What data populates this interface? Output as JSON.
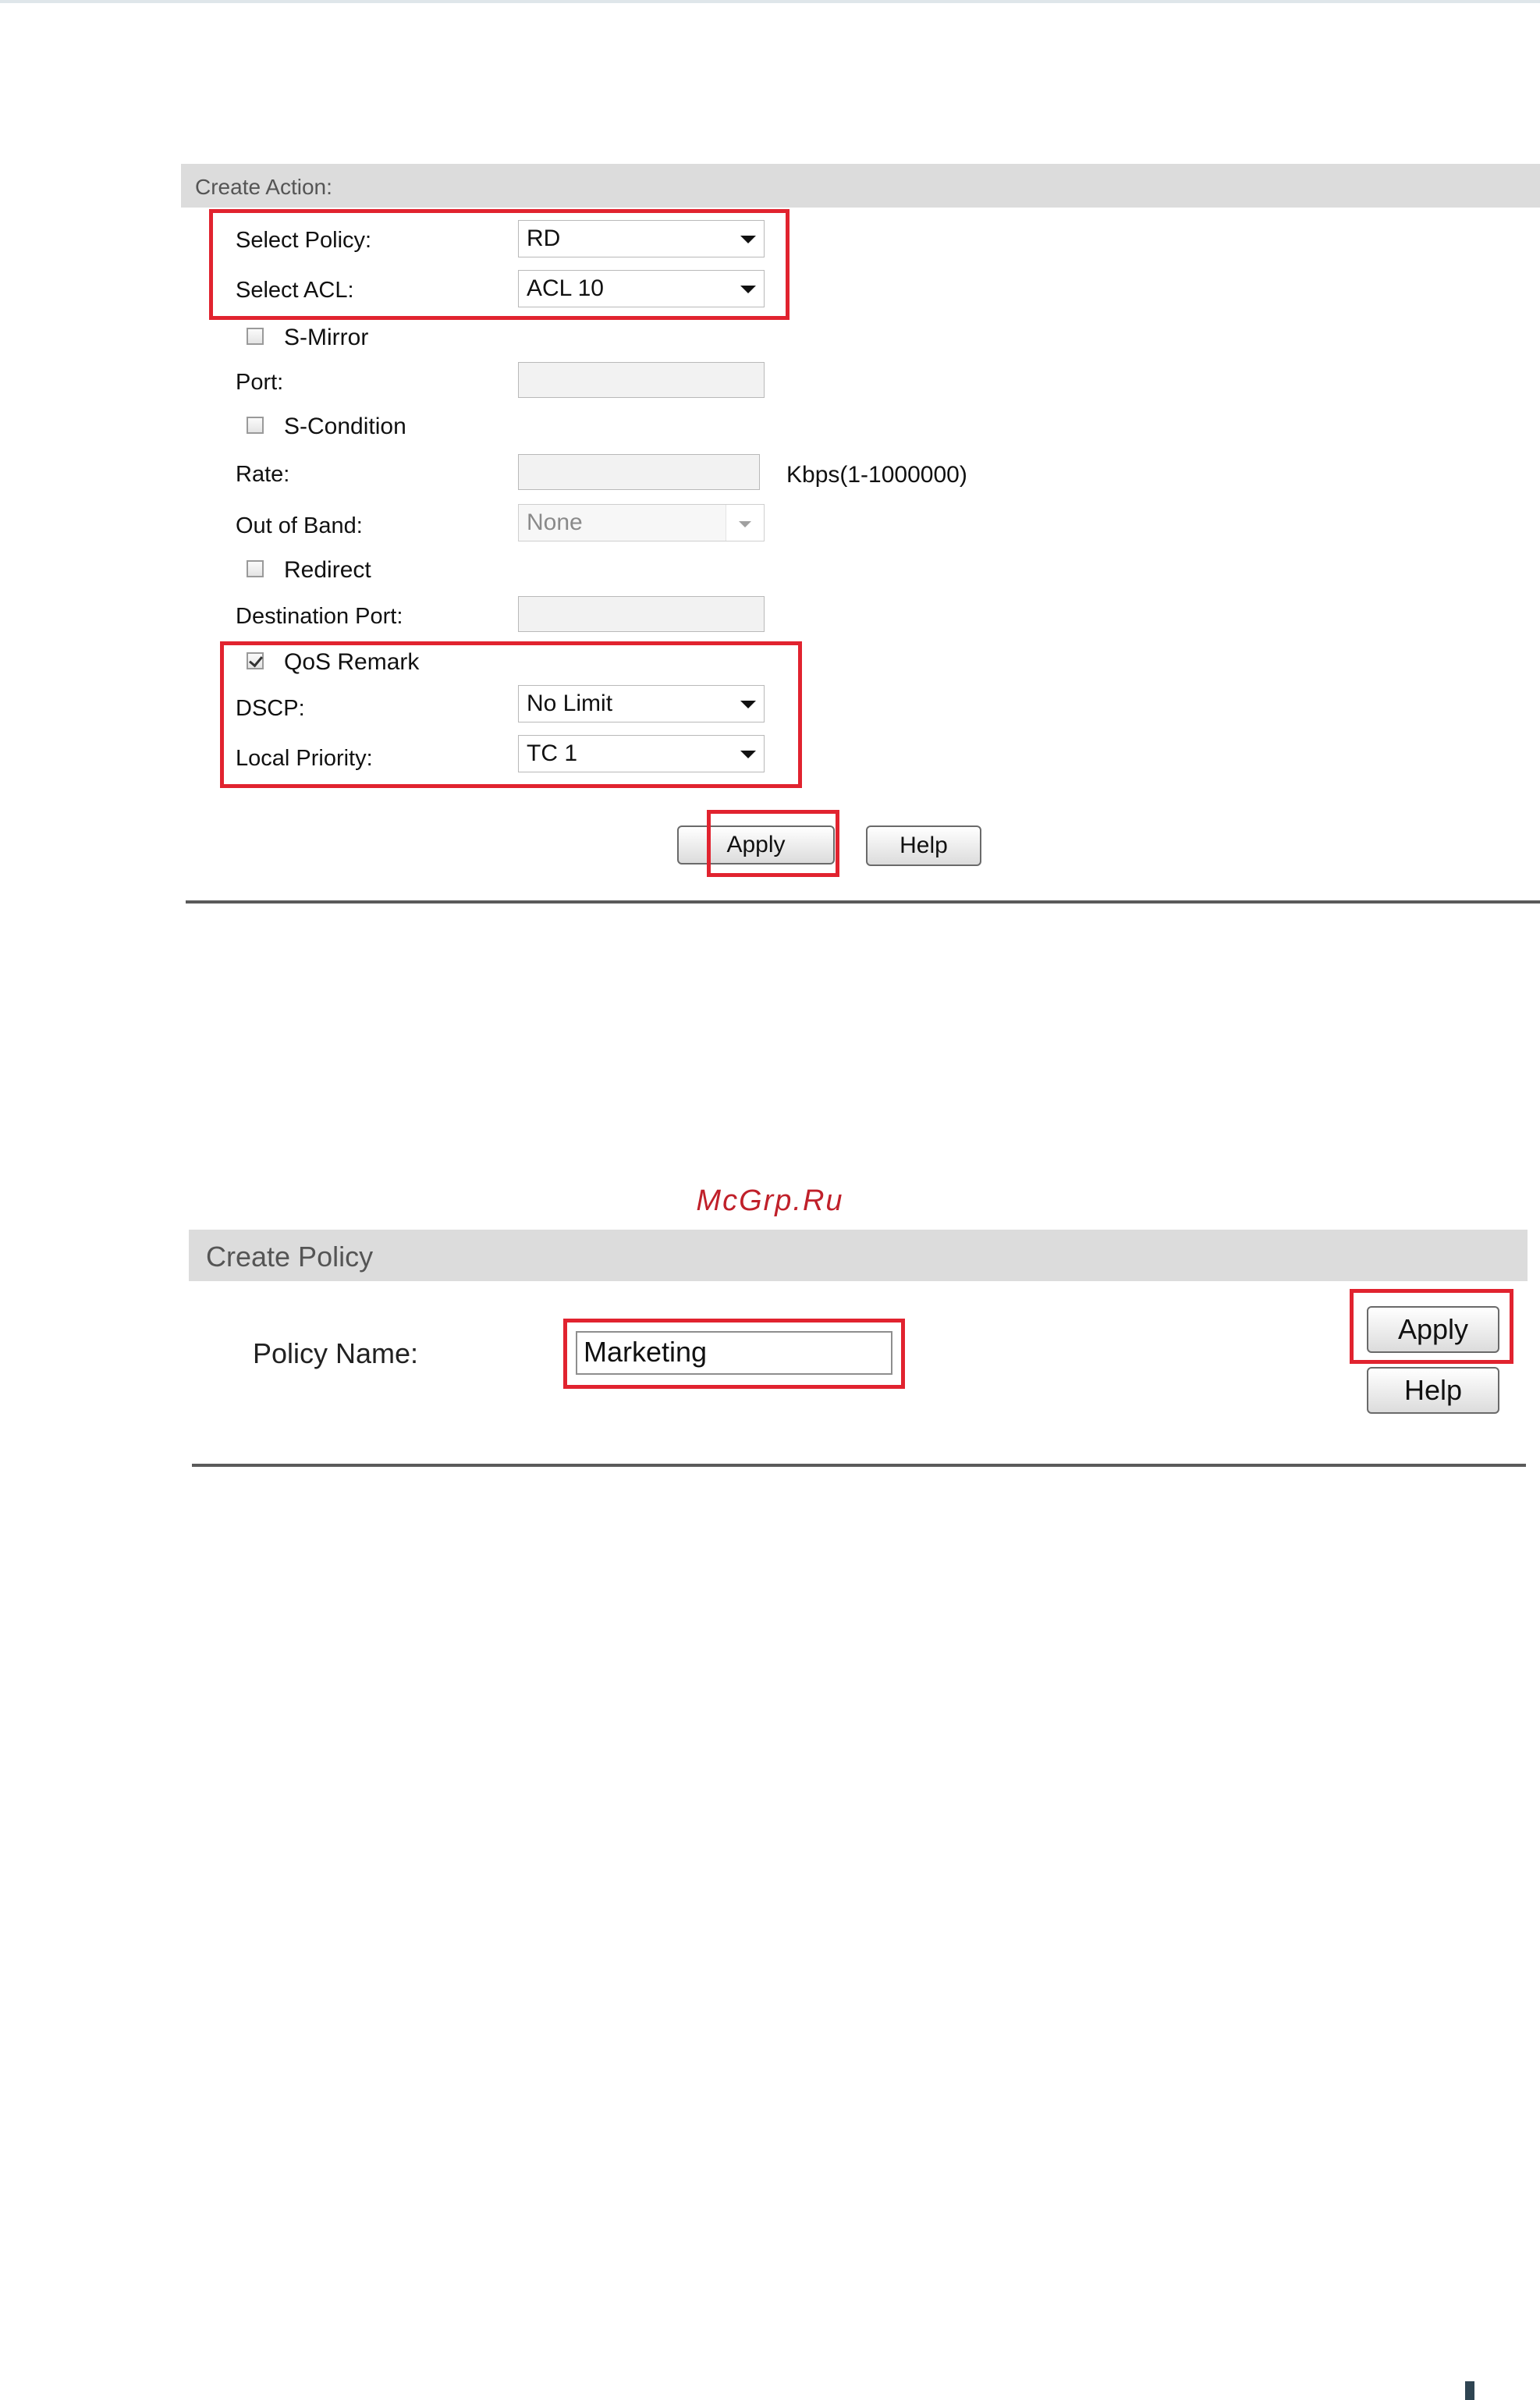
{
  "create_action": {
    "header": "Create Action:",
    "select_policy": {
      "label": "Select Policy:",
      "value": "RD"
    },
    "select_acl": {
      "label": "Select ACL:",
      "value": "ACL 10"
    },
    "s_mirror": {
      "label": "S-Mirror",
      "checked": false
    },
    "port": {
      "label": "Port:",
      "value": ""
    },
    "s_condition": {
      "label": "S-Condition",
      "checked": false
    },
    "rate": {
      "label": "Rate:",
      "value": "",
      "unit": "Kbps(1-1000000)"
    },
    "out_of_band": {
      "label": "Out of Band:",
      "value": "None"
    },
    "redirect": {
      "label": "Redirect",
      "checked": false
    },
    "destination_port": {
      "label": "Destination Port:",
      "value": ""
    },
    "qos_remark": {
      "label": "QoS Remark",
      "checked": true
    },
    "dscp": {
      "label": "DSCP:",
      "value": "No Limit"
    },
    "local_priority": {
      "label": "Local Priority:",
      "value": "TC 1"
    },
    "apply_label": "Apply",
    "help_label": "Help"
  },
  "watermark": "McGrp.Ru",
  "create_policy": {
    "header": "Create Policy",
    "policy_name": {
      "label": "Policy Name:",
      "value": "Marketing"
    },
    "apply_label": "Apply",
    "help_label": "Help"
  },
  "colors": {
    "highlight": "#e1232f",
    "header_bg": "#dcdcdc",
    "watermark": "#c0202a"
  }
}
